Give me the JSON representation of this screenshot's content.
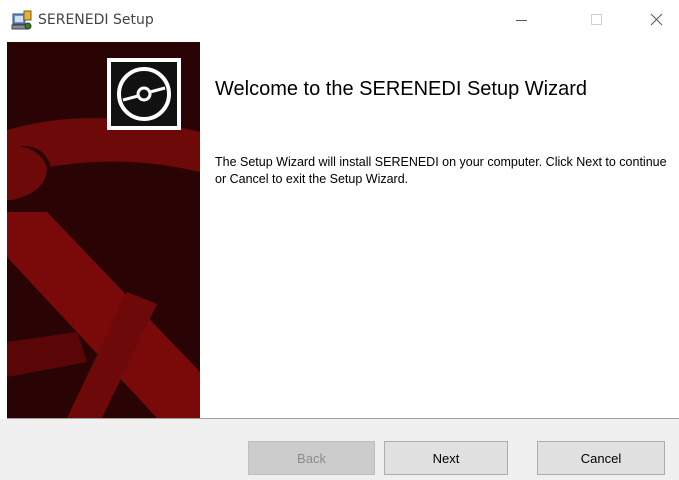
{
  "window": {
    "title": "SERENEDI Setup"
  },
  "content": {
    "heading": "Welcome to the SERENEDI Setup Wizard",
    "body": "The Setup Wizard will install SERENEDI on your computer. Click Next to continue or Cancel to exit the Setup Wizard."
  },
  "buttons": {
    "back": "Back",
    "next": "Next",
    "cancel": "Cancel",
    "back_enabled": false
  },
  "icons": {
    "app": "installer-icon",
    "banner": "disc-icon",
    "minimize": "minimize-icon",
    "maximize": "maximize-icon",
    "close": "close-icon"
  },
  "colors": {
    "banner_dark": "#2a0404",
    "banner_red": "#7a0a0a",
    "button_face": "#e1e1e1",
    "footer": "#f0f0f0"
  }
}
